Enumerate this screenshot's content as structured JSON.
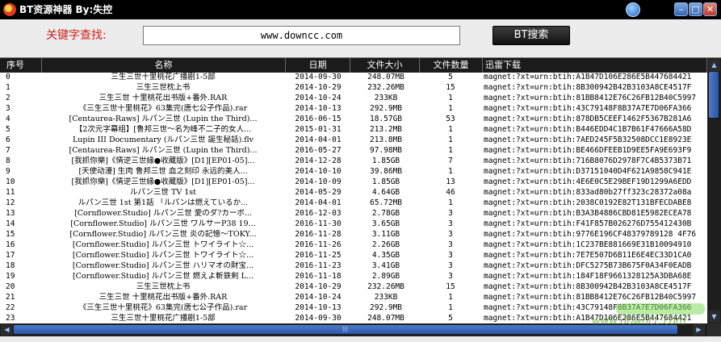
{
  "window": {
    "title": "BT资源神器  By:失控",
    "buttons": {
      "minimize": "–",
      "close": "✕"
    },
    "skin_icon": "skin-icon"
  },
  "search": {
    "label": "关键字查找:",
    "value": "www.downcc.com",
    "button": "BT搜索"
  },
  "grid": {
    "columns": [
      "序号",
      "名称",
      "日期",
      "文件大小",
      "文件数量",
      "迅雷下载"
    ],
    "rows": [
      [
        "0",
        "三生三世十里桃花广播剧1-5部",
        "2014-09-30",
        "248.07MB",
        "5",
        "magnet:?xt=urn:btih:A1B47D106E286E5B447684421"
      ],
      [
        "1",
        "三生三世枕上书",
        "2014-10-29",
        "232.26MB",
        "15",
        "magnet:?xt=urn:btih:8B300942B42B3103A8CE4517F"
      ],
      [
        "2",
        "三生三世 十里桃花出书版+番外.RAR",
        "2014-10-24",
        "233KB",
        "1",
        "magnet:?xt=urn:btih:81BB8412E76C26FB12B40C5997"
      ],
      [
        "3",
        "《三生三世十里桃花》63集完(唐七公子作品).rar",
        "2014-10-13",
        "292.9MB",
        "1",
        "magnet:?xt=urn:btih:43C79148F8B37A7E7D06FA366"
      ],
      [
        "4",
        "[Centaurea-Raws] ルパン三世 (Lupin the Third)...",
        "2016-06-15",
        "18.57GB",
        "53",
        "magnet:?xt=urn:btih:878DB5CEEF1462F5367B281A6"
      ],
      [
        "5",
        "【2次元字幕组】[鲁邦三世～名为峰不二子的女人...",
        "2015-01-31",
        "213.2MB",
        "1",
        "magnet:?xt=urn:btih:B446EDD4C1B7B61F47666A58D"
      ],
      [
        "6",
        "Lupin III Documentary (ルパン三世 誕生秘話).flv",
        "2014-04-01",
        "213.8MB",
        "1",
        "magnet:?xt=urn:btih:7AED245F5B32508DCC1E8923E"
      ],
      [
        "7",
        "[Centaurea-Raws] ルパン三世 (Lupin the Third)...",
        "2016-05-27",
        "97.98MB",
        "1",
        "magnet:?xt=urn:btih:BE466DFEEB1D9EE5FA9E693F9"
      ],
      [
        "8",
        "[我抓你樂]《情逆三世緣●收藏版》[D1][EP01-05]...",
        "2014-12-28",
        "1.85GB",
        "7",
        "magnet:?xt=urn:btih:716B8076D2978F7C4B5373B71"
      ],
      [
        "9",
        "[天使动漫] 生肉 鲁邦三世 血之刻印 永远的美人...",
        "2014-10-10",
        "39.86MB",
        "1",
        "magnet:?xt=urn:btih:D37151040D4F621A9858C941E"
      ],
      [
        "10",
        "[我抓你樂]《情逆三世緣●收藏版》[D1][EP01-05]...",
        "2014-10-09",
        "1.85GB",
        "13",
        "magnet:?xt=urn:btih:4E6E0C5E29BEF19D1299A6EDD"
      ],
      [
        "11",
        "ルパン三世 TV 1st",
        "2014-05-29",
        "4.64GB",
        "46",
        "magnet:?xt=urn:btih:833ad80b27ff323c28372a08a"
      ],
      [
        "12",
        "ルパン三世 1st 第1話 「ルパンは燃えているか...",
        "2014-04-01",
        "65.72MB",
        "1",
        "magnet:?xt=urn:btih:2038C0192E82T131BFECDABE8"
      ],
      [
        "13",
        "[Cornflower.Studio] ルパン三世 愛のダ?カーポ...",
        "2016-12-03",
        "2.78GB",
        "3",
        "magnet:?xt=urn:btih:B3A3B4886CBD81E5982ECEA78"
      ],
      [
        "14",
        "[Cornflower.Studio] ルパン三世 ワルサーP38 19...",
        "2016-11-30",
        "3.65GB",
        "3",
        "magnet:?xt=urn:btih:F41F857B026276D755412430B"
      ],
      [
        "15",
        "[Cornflower.Studio] ルパン三世 炎の記憶～TOKY...",
        "2016-11-28",
        "3.11GB",
        "3",
        "magnet:?xt=urn:btih:9776E196CF48379789128 4F76"
      ],
      [
        "16",
        "[Cornflower.Studio] ルパン三世 トワイライト☆...",
        "2016-11-26",
        "2.26GB",
        "3",
        "magnet:?xt=urn:btih:1C237BE881669E31B10094910"
      ],
      [
        "17",
        "[Cornflower.Studio] ルパン三世 トワイライト☆...",
        "2016-11-25",
        "4.35GB",
        "3",
        "magnet:?xt=urn:btih:7E7E507D6B11E6E4EC33D1CA0"
      ],
      [
        "18",
        "[Cornflower.Studio] ルパン三世 ハリマオの財宝...",
        "2016-11-23",
        "3.41GB",
        "3",
        "magnet:?xt=urn:btih:DFC5275B73B675F0A34F0EADB"
      ],
      [
        "19",
        "[Cornflower.Studio] ルパン三世 燃えよ斬鉄剣 L...",
        "2016-11-18",
        "2.89GB",
        "3",
        "magnet:?xt=urn:btih:184F18F9661328125A3DBA68E"
      ],
      [
        "20",
        "三生三世枕上书",
        "2014-10-29",
        "232.26MB",
        "15",
        "magnet:?xt=urn:btih:8B300942B42B3103A8CE4517F"
      ],
      [
        "21",
        "三生三世 十里桃花出书版+番外.RAR",
        "2014-10-24",
        "233KB",
        "1",
        "magnet:?xt=urn:btih:81BB8412E76C26FB12B40C5997"
      ],
      [
        "22",
        "《三生三世十里桃花》63集完(唐七公子作品).rar",
        "2014-10-13",
        "292.9MB",
        "1",
        "magnet:?xt=urn:btih:43C79148F8B37A7E7D06FA366"
      ],
      [
        "23",
        "三生三世十里桃花广播剧1-5部",
        "2014-09-30",
        "248.07MB",
        "5",
        "magnet:?xt=urn:btih:A1B47D106E286E5B447684421"
      ]
    ]
  },
  "watermark": {
    "text": "www.downcc.com"
  },
  "colors": {
    "titlebar": "#000000",
    "label_red": "#d21f1f",
    "scroll_blue": "#2a55a8"
  }
}
